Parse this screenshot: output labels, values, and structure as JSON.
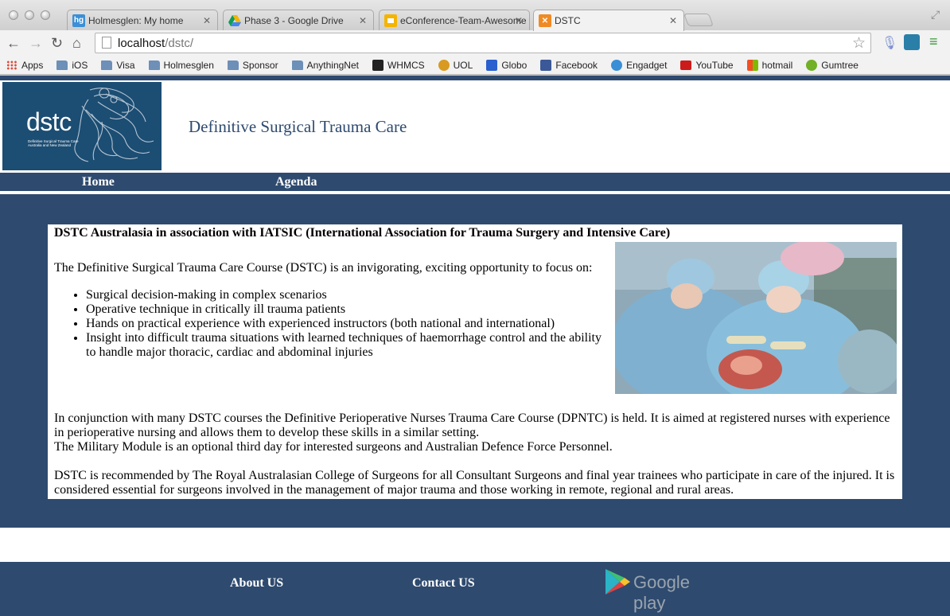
{
  "browser": {
    "tabs": [
      {
        "title": "Holmesglen: My home",
        "favicon": "hg",
        "favicon_color": "#3a8fd6"
      },
      {
        "title": "Phase 3 - Google Drive",
        "favicon": "drive-icon",
        "favicon_color": "#f4b400"
      },
      {
        "title": "eConference-Team-Awesome",
        "favicon": "slides-icon",
        "favicon_color": "#f4b400"
      },
      {
        "title": "DSTC",
        "favicon": "xampp-icon",
        "favicon_color": "#f08a24"
      }
    ],
    "url_host": "localhost",
    "url_path": "/dstc/",
    "bookmarks": [
      {
        "label": "Apps",
        "icon": "apps-grid-icon"
      },
      {
        "label": "iOS",
        "icon": "folder-icon"
      },
      {
        "label": "Visa",
        "icon": "folder-icon"
      },
      {
        "label": "Holmesglen",
        "icon": "folder-icon"
      },
      {
        "label": "Sponsor",
        "icon": "folder-icon"
      },
      {
        "label": "AnythingNet",
        "icon": "folder-icon"
      },
      {
        "label": "WHMCS",
        "icon": "whmcs-icon"
      },
      {
        "label": "UOL",
        "icon": "uol-icon"
      },
      {
        "label": "Globo",
        "icon": "globo-icon"
      },
      {
        "label": "Facebook",
        "icon": "facebook-icon"
      },
      {
        "label": "Engadget",
        "icon": "rss-icon"
      },
      {
        "label": "YouTube",
        "icon": "youtube-icon"
      },
      {
        "label": "hotmail",
        "icon": "windows-icon"
      },
      {
        "label": "Gumtree",
        "icon": "gumtree-icon"
      }
    ]
  },
  "site": {
    "logo_text": "dstc",
    "logo_sub": "Definitive Surgical Trauma Care\nAustralia and New Zealand",
    "title": "Definitive Surgical Trauma Care",
    "nav": {
      "home": "Home",
      "agenda": "Agenda"
    },
    "accent": "#2e4a6f"
  },
  "content": {
    "heading": "DSTC Australasia in association with IATSIC (International Association for Trauma Surgery and Intensive Care)",
    "intro": "The Definitive Surgical Trauma Care Course (DSTC) is an invigorating, exciting opportunity to focus on:",
    "bullets": [
      "Surgical decision-making in complex scenarios",
      "Operative technique in critically ill trauma patients",
      "Hands on practical experience with experienced instructors (both national and international)",
      "Insight into difficult trauma situations with learned techniques of haemorrhage control and the ability to handle major thoracic, cardiac and abdominal injuries"
    ],
    "para2_line1": "In conjunction with many DSTC courses the Definitive Perioperative Nurses Trauma Care Course (DPNTC) is held. It is aimed at registered nurses with experience in perioperative nursing and allows them to develop these skills in a similar setting.",
    "para2_line2": "The Military Module is an optional third day for interested surgeons and Australian Defence Force Personnel.",
    "para3": "DSTC is recommended by The Royal Australasian College of Surgeons for all Consultant Surgeons and final year trainees who participate in care of the injured. It is considered essential for surgeons involved in the management of major trauma and those working in remote, regional and rural areas."
  },
  "footer": {
    "about": "About US",
    "contact": "Contact US",
    "google_play": "Google play"
  }
}
